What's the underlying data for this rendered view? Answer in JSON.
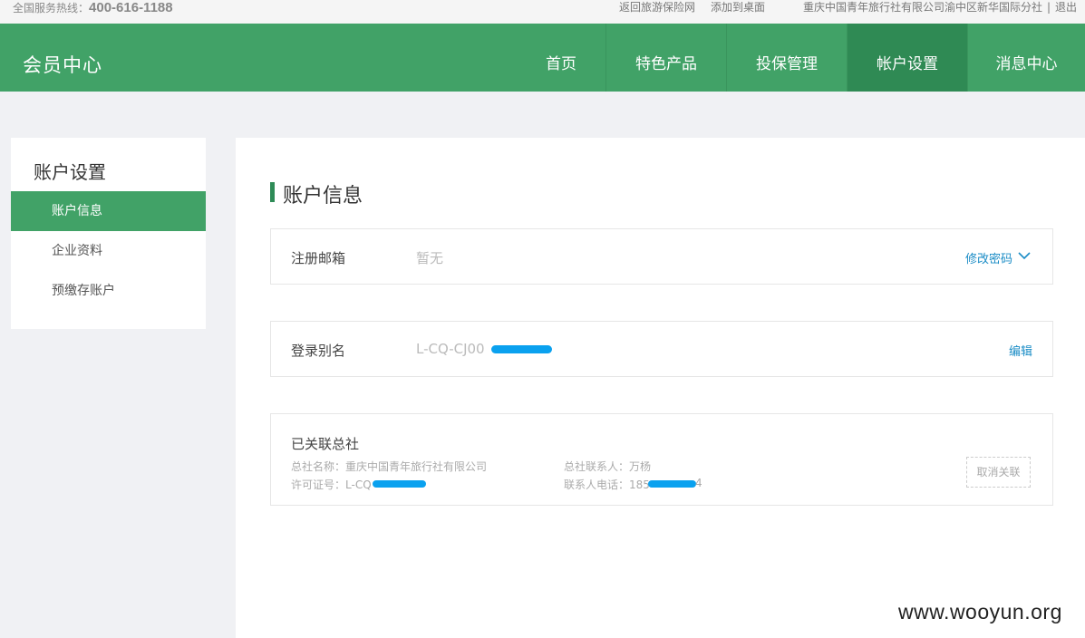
{
  "topbar": {
    "hotline_label": "全国服务热线：",
    "hotline_number": "400-616-1188",
    "links": [
      "返回旅游保险网",
      "添加到桌面"
    ],
    "company": "重庆中国青年旅行社有限公司渝中区新华国际分社",
    "separator": "|",
    "logout": "退出"
  },
  "header": {
    "brand": "会员中心",
    "nav": [
      "首页",
      "特色产品",
      "投保管理",
      "帐户设置",
      "消息中心"
    ],
    "active_index": 3
  },
  "sidebar": {
    "title": "账户设置",
    "items": [
      "账户信息",
      "企业资料",
      "预缴存账户"
    ],
    "active_index": 0
  },
  "main": {
    "section_title": "账户信息",
    "email_row": {
      "label": "注册邮箱",
      "value": "暂无",
      "action": "修改密码"
    },
    "alias_row": {
      "label": "登录别名",
      "value": "L-CQ-CJ00",
      "action": "编辑"
    },
    "linked": {
      "title": "已关联总社",
      "name_label": "总社名称：",
      "name_value": "重庆中国青年旅行社有限公司",
      "contact_label": "总社联系人：",
      "contact_value": "万杨",
      "license_label": "许可证号：",
      "license_value": "L-CQ",
      "phone_label": "联系人电话：",
      "phone_value": "185",
      "phone_tail": "4",
      "unlink": "取消关联"
    }
  },
  "watermark": "www.wooyun.org",
  "colors": {
    "brand_green": "#41a267",
    "active_green": "#2f8a54",
    "link_blue": "#1a8cc6",
    "redaction": "#0aa1ef"
  }
}
